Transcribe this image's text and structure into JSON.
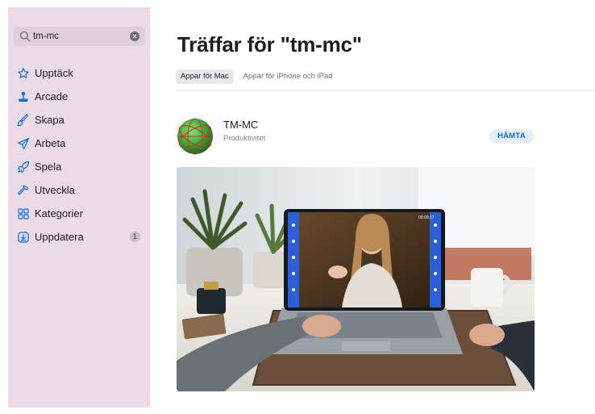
{
  "search": {
    "value": "tm-mc"
  },
  "sidebar": {
    "items": [
      {
        "label": "Upptäck",
        "icon": "star-icon"
      },
      {
        "label": "Arcade",
        "icon": "joystick-icon"
      },
      {
        "label": "Skapa",
        "icon": "brush-icon"
      },
      {
        "label": "Arbeta",
        "icon": "paperplane-icon"
      },
      {
        "label": "Spela",
        "icon": "rocket-icon"
      },
      {
        "label": "Utveckla",
        "icon": "hammer-icon"
      },
      {
        "label": "Kategorier",
        "icon": "grid-icon"
      },
      {
        "label": "Uppdatera",
        "icon": "download-icon",
        "badge": "1"
      }
    ]
  },
  "main": {
    "title": "Träffar för \"tm-mc\"",
    "tabs": [
      {
        "label": "Appar för Mac",
        "active": true
      },
      {
        "label": "Appar för iPhone och iPad",
        "active": false
      }
    ],
    "result": {
      "name": "TM-MC",
      "category": "Produktivitet",
      "get_label": "HÄMTA",
      "video_timer": "00:00:17"
    }
  },
  "colors": {
    "accent": "#0a6ce8",
    "sidebar_bg": "#eadbe6"
  }
}
